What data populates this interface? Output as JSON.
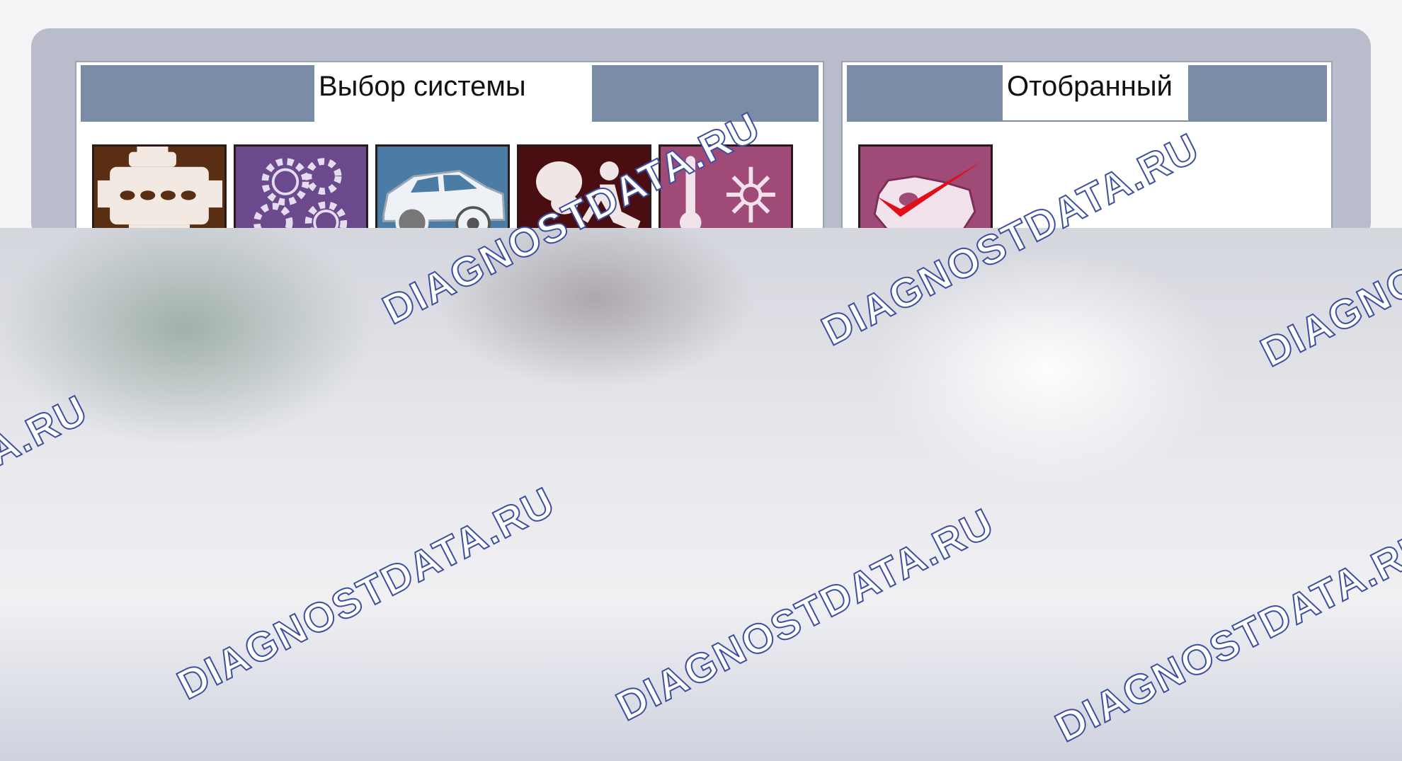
{
  "panels": {
    "system_select": {
      "title": "Выбор системы",
      "icons": [
        "engine-icon",
        "transmission-gears-icon",
        "chassis-brakes-icon",
        "airbag-seat-icon",
        "climate-control-icon"
      ]
    },
    "selected": {
      "title": "Отобранный",
      "icons": [
        "selected-system-check-icon"
      ]
    }
  },
  "watermark": {
    "text": "DIAGNOSTDATA.RU"
  },
  "colors": {
    "frame": "#b9bccb",
    "header_bar": "#7b8ca6",
    "engine_tile": "#5a2e12",
    "transmission_tile": "#6a4a8c",
    "chassis_tile": "#4a7ca6",
    "airbag_tile": "#4a0e12",
    "climate_tile": "#a04a78",
    "check_red": "#e0101a"
  }
}
